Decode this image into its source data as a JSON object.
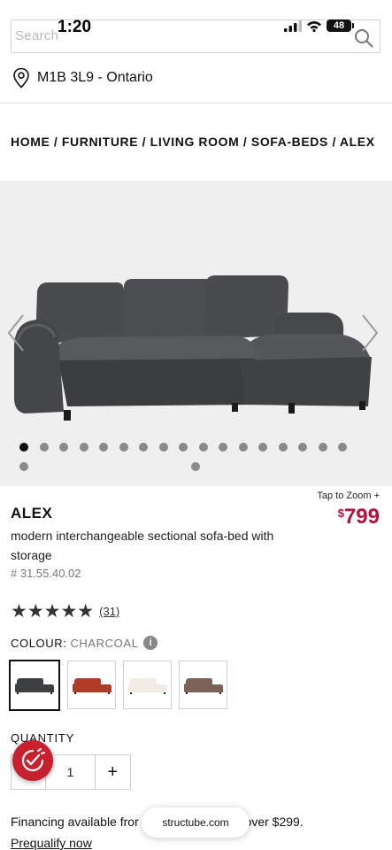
{
  "status_bar": {
    "time": "1:20",
    "battery": "48"
  },
  "search": {
    "placeholder": "Search"
  },
  "location": {
    "text": "M1B 3L9 - Ontario"
  },
  "breadcrumb": [
    "HOME",
    "FURNITURE",
    "LIVING ROOM",
    "SOFA-BEDS",
    "ALEX"
  ],
  "breadcrumb_sep": " / ",
  "gallery": {
    "slide_count": 18,
    "active_index": 0
  },
  "product": {
    "zoom_hint": "Tap to Zoom  +",
    "price_currency": "$",
    "price_amount": "799",
    "name": "ALEX",
    "description": "modern interchangeable sectional sofa-bed with storage",
    "sku": "# 31.55.40.02",
    "rating_stars": "★★★★★",
    "rating_value": 5,
    "review_count": "(31)"
  },
  "colour": {
    "label": "COLOUR:",
    "selected": "CHARCOAL",
    "info_glyph": "i",
    "swatches": [
      {
        "color": "#3e3f41"
      },
      {
        "color": "#b33a26"
      },
      {
        "color": "#f1ede4"
      },
      {
        "color": "#7a6258"
      }
    ]
  },
  "quantity": {
    "label": "QUANTITY",
    "value": "1",
    "plus": "+"
  },
  "financing": {
    "text": "Financing available from ... over $299.",
    "before": "Financing available fror",
    "after": "; over $299.",
    "prequalify": "Prequalify now"
  },
  "browser": {
    "url": "structube.com"
  }
}
